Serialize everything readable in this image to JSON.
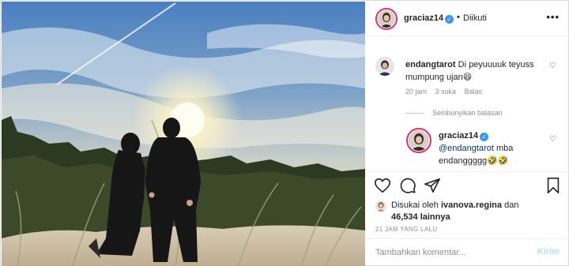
{
  "post": {
    "author": "graciaz14",
    "separator": "•",
    "follow_status": "Diikuti",
    "more_icon": "more-icon",
    "verified_icon": "verified-badge-icon"
  },
  "comments": [
    {
      "username": "endangtarot",
      "text": "Di peyuuuuk teyuss mumpung ujan",
      "emoji": "😄",
      "time": "20 jam",
      "likes": "3 suka",
      "reply_label": "Balas"
    }
  ],
  "hide_replies_label": "Sembunyikan balasan",
  "reply": {
    "username": "graciaz14",
    "mention": "@endangtarot",
    "text": "mba endanggggg",
    "emoji": "🤣🤣"
  },
  "likes": {
    "prefix": "Disukai oleh",
    "user": "ivanova.regina",
    "joiner": "dan",
    "count": "46,534 lainnya"
  },
  "timestamp": "21 JAM YANG LALU",
  "comment_box": {
    "placeholder": "Tambahkan komentar...",
    "submit_label": "Kirim"
  },
  "colors": {
    "verified": "#3897f0",
    "story_ring": "#e1306c",
    "submit_disabled": "#b2dffc",
    "meta_text": "#8e8e8e"
  }
}
